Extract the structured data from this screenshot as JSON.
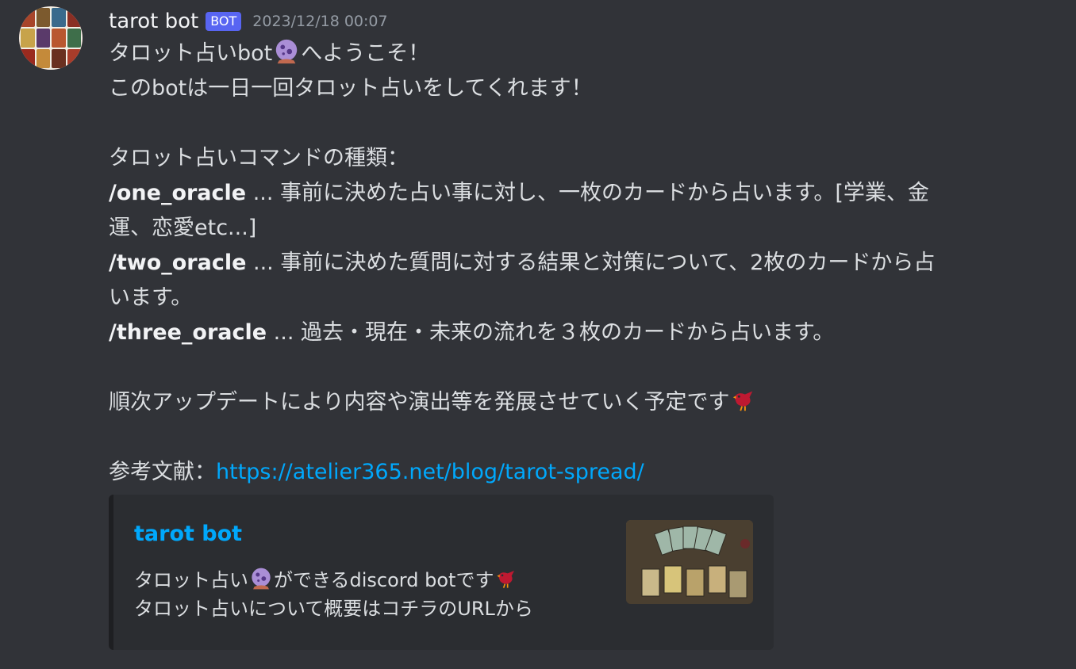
{
  "message": {
    "username": "tarot bot",
    "bot_tag": "BOT",
    "timestamp": "2023/12/18 00:07",
    "line1_pre": "タロット占いbot",
    "line1_post": "へようこそ！",
    "line2": "このbotは一日一回タロット占いをしてくれます！",
    "commands_heading": "タロット占いコマンドの種類：",
    "cmd1_name": "/one_oracle",
    "cmd1_desc": " ... 事前に決めた占い事に対し、一枚のカードから占います。[学業、金",
    "cmd1_desc_cont": "運、恋愛etc...]",
    "cmd2_name": "/two_oracle",
    "cmd2_desc": " ... 事前に決めた質問に対する結果と対策について、2枚のカードから占",
    "cmd2_desc_cont": "います。",
    "cmd3_name": "/three_oracle",
    "cmd3_desc": " ... 過去・現在・未来の流れを３枚のカードから占います。",
    "update_note": "順次アップデートにより内容や演出等を発展させていく予定です",
    "reference_label": "参考文献：",
    "reference_url": "https://atelier365.net/blog/tarot-spread/"
  },
  "embed": {
    "title": "tarot bot",
    "desc_line1_pre": "タロット占い",
    "desc_line1_mid": "ができるdiscord botです",
    "desc_line2": "タロット占いについて概要はコチラのURLから"
  },
  "icons": {
    "crystal_ball": "crystal-ball-icon",
    "bird": "bird-icon"
  },
  "colors": {
    "background": "#313338",
    "bot_tag": "#5865f2",
    "link": "#00a8fc",
    "embed_bg": "#2b2d31"
  }
}
